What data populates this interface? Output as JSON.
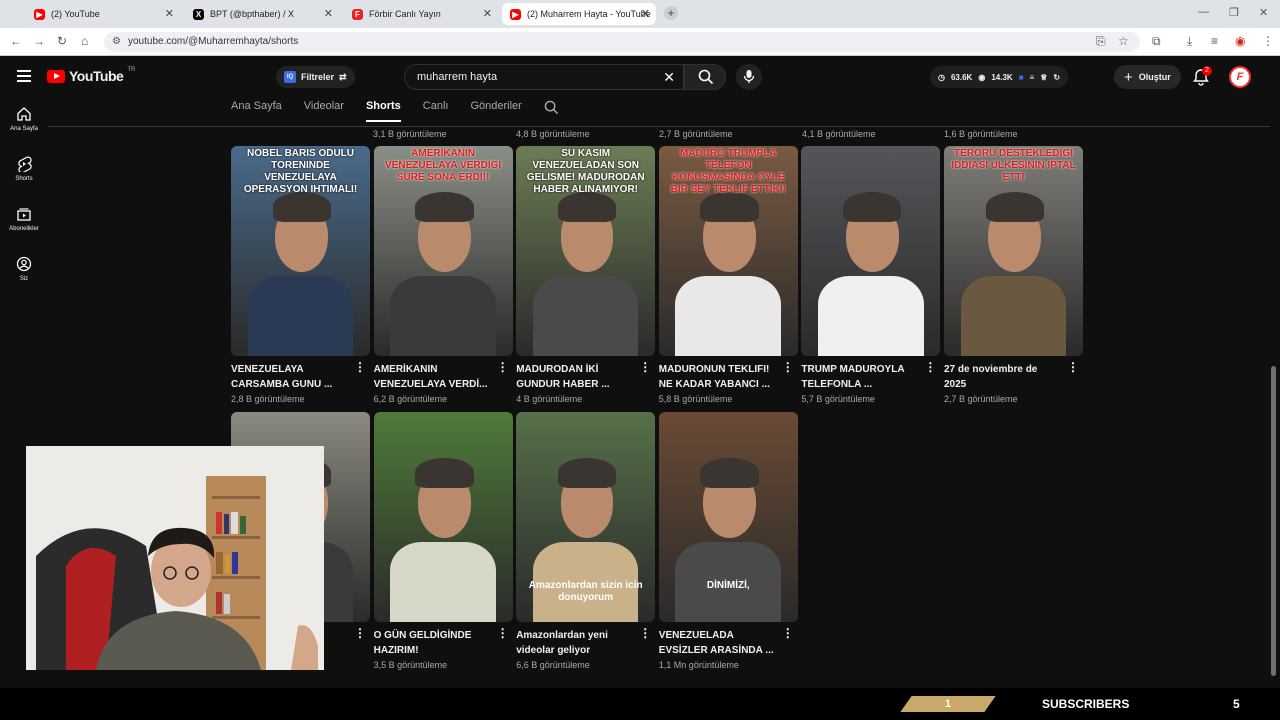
{
  "browser": {
    "tabs": [
      {
        "title": "(2) YouTube",
        "icon": "youtube-icon"
      },
      {
        "title": "BPT (@bpthaber) / X",
        "icon": "x-icon"
      },
      {
        "title": "Förbir Canlı Yayın",
        "icon": "forbir-icon"
      },
      {
        "title": "(2) Muharrem Hayta - YouTube",
        "icon": "youtube-icon"
      }
    ],
    "url": "youtube.com/@Muharremhayta/shorts"
  },
  "youtube": {
    "logo_text": "YouTube",
    "region": "TR",
    "filters_label": "Filtreler",
    "filters_badge": "IQ",
    "search_value": "muharrem hayta",
    "stats": {
      "a": "63.6K",
      "b": "14.3K"
    },
    "create_label": "Oluştur",
    "notif_count": "2",
    "sidebar": [
      {
        "label": "Ana Sayfa",
        "icon": "home-icon"
      },
      {
        "label": "Shorts",
        "icon": "shorts-icon"
      },
      {
        "label": "Abonelikler",
        "icon": "subscriptions-icon"
      },
      {
        "label": "Siz",
        "icon": "you-icon"
      }
    ],
    "channel_tabs": [
      "Ana Sayfa",
      "Videolar",
      "Shorts",
      "Canlı",
      "Gönderiler"
    ],
    "prev_row_views": [
      "3,1 B görüntüleme",
      "4,8 B görüntüleme",
      "2,7 B görüntüleme",
      "4,1 B görüntüleme",
      "1,6 B görüntüleme"
    ],
    "shorts": [
      {
        "title": "VENEZUELAYA CARSAMBA GUNU ...",
        "views": "2,8 B görüntüleme",
        "overlay": "NOBEL BARIS ODULU TORENINDE VENEZUELAYA OPERASYON IHTIMALI!",
        "overlay_color": "white",
        "bg": "#4a6a8a",
        "shirt": "#2b3a55"
      },
      {
        "title": "AMERİKANIN VENEZUELAYA VERDİ...",
        "views": "6,2 B görüntüleme",
        "overlay": "AMERIKANIN VENEZUELAYA VERDIGI SURE SONA ERDI!!",
        "overlay_color": "red",
        "bg": "#8a8f86",
        "shirt": "#3a3a3a"
      },
      {
        "title": "MADURODAN İKİ GUNDUR HABER ...",
        "views": "4 B görüntüleme",
        "overlay": "SU KASIM VENEZUELADAN SON GELISME! MADURODAN HABER ALINAMIYOR!",
        "overlay_color": "white",
        "bg": "#6b7d55",
        "shirt": "#4a4a4a"
      },
      {
        "title": "MADURONUN TEKLIFI! NE KADAR YABANCI ...",
        "views": "5,8 B görüntüleme",
        "overlay": "MADURO TRUMPLA TELEFON KONUSMASINDA OYLE BIR SEY TEKLIF ETTIKI!",
        "overlay_color": "red",
        "bg": "#7a5a42",
        "shirt": "#e8e8e8"
      },
      {
        "title": "TRUMP MADUROYLA TELEFONLA ...",
        "views": "5,7 B görüntüleme",
        "overlay": "",
        "overlay_color": "white",
        "bg": "#55565a",
        "shirt": "#f0f0f0"
      },
      {
        "title": "27 de noviembre de 2025",
        "views": "2,7 B görüntüleme",
        "overlay": "TERORU DESTEKLEDIGI IDDIASI ULKESININ IPTAL ETTI",
        "overlay_color": "red",
        "bg": "#7f7d78",
        "shirt": "#6a5840"
      },
      {
        "title": "",
        "views": "",
        "overlay": "",
        "overlay_color": "red",
        "bg": "#8a8a80",
        "shirt": "#3a3a3a"
      },
      {
        "title": "O GÜN GELDİGİNDE HAZIRIM!",
        "views": "3,5 B görüntüleme",
        "overlay": "",
        "overlay_color": "white",
        "bg": "#4f7a3a",
        "shirt": "#d8d8c8"
      },
      {
        "title": "Amazonlardan yeni videolar geliyor",
        "views": "6,6 B görüntüleme",
        "overlay": "",
        "overlay_color": "white",
        "bg": "#56704a",
        "shirt": "#c9b28a",
        "overlay_bottom": "Amazonlardan sizin icin donuyorum"
      },
      {
        "title": "VENEZUELADA EVSİZLER ARASİNDA ...",
        "views": "1,1 Mn görüntüleme",
        "overlay": "",
        "overlay_color": "white",
        "bg": "#6a4a35",
        "shirt": "#4a4a4a",
        "overlay_bottom": "DİNİMİZİ,"
      }
    ]
  },
  "overlay": {
    "sub_count": "1",
    "sub_label": "SUBSCRIBERS",
    "sub_goal": "5"
  }
}
